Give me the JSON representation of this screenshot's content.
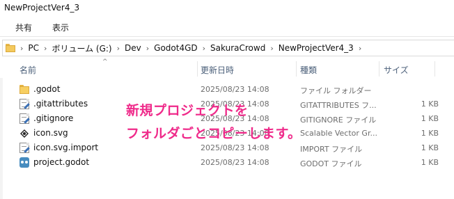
{
  "window": {
    "title": "NewProjectVer4_3"
  },
  "ribbon": {
    "tabs": [
      "共有",
      "表示"
    ]
  },
  "address": {
    "crumbs": [
      "PC",
      "ボリューム (G:)",
      "Dev",
      "Godot4GD",
      "SakuraCrowd",
      "NewProjectVer4_3"
    ],
    "separator": "›",
    "dropdown": "⌄"
  },
  "columns": {
    "name": "名前",
    "date": "更新日時",
    "type": "種類",
    "size": "サイズ",
    "sort_indicator": "^"
  },
  "files": [
    {
      "name": ".godot",
      "date": "2025/08/23 14:08",
      "type": "ファイル フォルダー",
      "size": "",
      "icon": "folder-icon"
    },
    {
      "name": ".gitattributes",
      "date": "2025/08/23 14:08",
      "type": "GITATTRIBUTES フ...",
      "size": "1 KB",
      "icon": "document-icon"
    },
    {
      "name": ".gitignore",
      "date": "2025/08/23 14:08",
      "type": "GITIGNORE ファイル",
      "size": "1 KB",
      "icon": "document-icon"
    },
    {
      "name": "icon.svg",
      "date": "2025/08/23 14:08",
      "type": "Scalable Vector Gr...",
      "size": "1 KB",
      "icon": "svg-file-icon"
    },
    {
      "name": "icon.svg.import",
      "date": "2025/08/23 14:08",
      "type": "IMPORT ファイル",
      "size": "1 KB",
      "icon": "document-icon"
    },
    {
      "name": "project.godot",
      "date": "2025/08/23 14:08",
      "type": "GODOT ファイル",
      "size": "1 KB",
      "icon": "godot-icon"
    }
  ],
  "annotation": {
    "line1": "新規プロジェクトを",
    "line2": "フォルダごとコピーします。",
    "color": "#ef2a8a"
  }
}
